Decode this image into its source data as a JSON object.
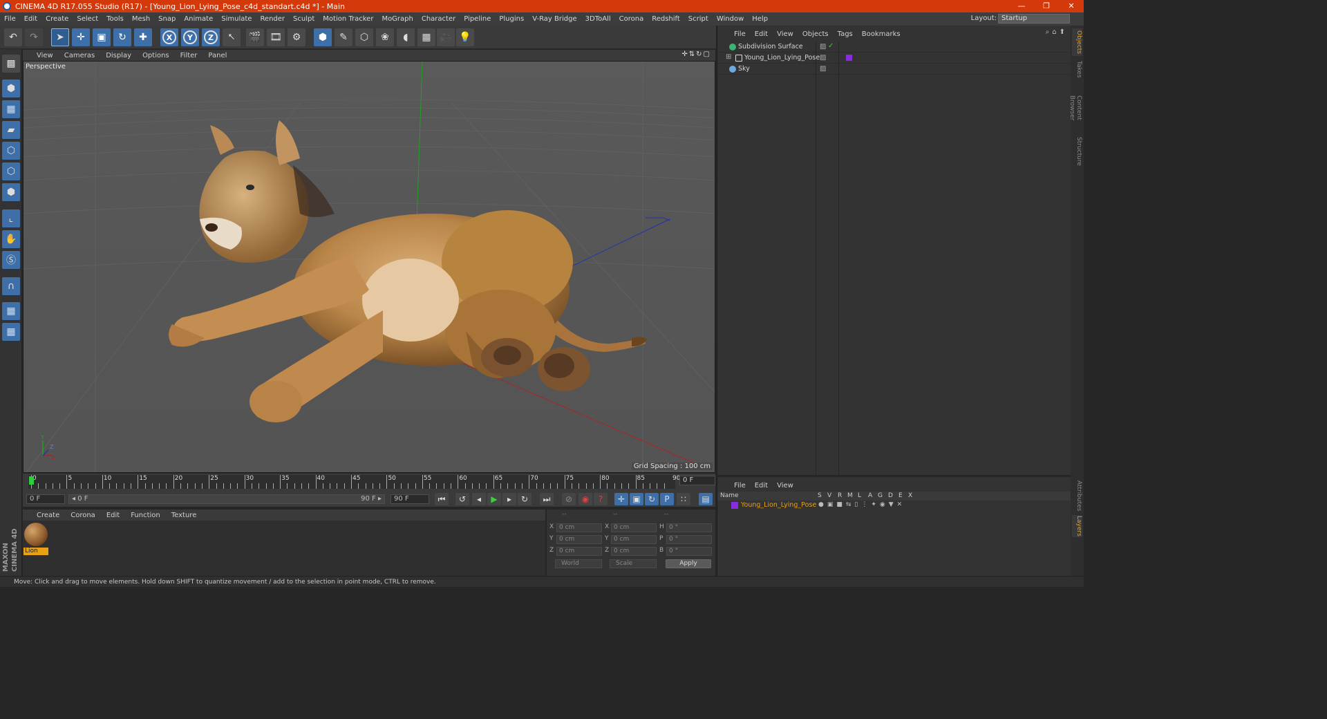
{
  "window": {
    "title": "CINEMA 4D R17.055 Studio (R17) - [Young_Lion_Lying_Pose_c4d_standart.c4d *] - Main",
    "minimize": "—",
    "restore": "❐",
    "close": "✕"
  },
  "menubar": {
    "items": [
      "File",
      "Edit",
      "Create",
      "Select",
      "Tools",
      "Mesh",
      "Snap",
      "Animate",
      "Simulate",
      "Render",
      "Sculpt",
      "Motion Tracker",
      "MoGraph",
      "Character",
      "Pipeline",
      "Plugins",
      "V-Ray Bridge",
      "3DToAll",
      "Corona",
      "Redshift",
      "Script",
      "Window",
      "Help"
    ],
    "layout_label": "Layout:",
    "layout_value": "Startup"
  },
  "toolbar": {
    "axis_x": "X",
    "axis_y": "Y",
    "axis_z": "Z"
  },
  "viewport": {
    "menu": [
      "View",
      "Cameras",
      "Display",
      "Options",
      "Filter",
      "Panel"
    ],
    "label": "Perspective",
    "grid_spacing": "Grid Spacing : 100 cm",
    "colors": {
      "x_axis": "#b22222",
      "y_axis": "#22a022",
      "z_axis": "#2233aa"
    }
  },
  "timeline": {
    "ticks": [
      "0",
      "5",
      "10",
      "15",
      "20",
      "25",
      "30",
      "35",
      "40",
      "45",
      "50",
      "55",
      "60",
      "65",
      "70",
      "75",
      "80",
      "85",
      "90"
    ],
    "current_frame": "0 F",
    "start_field": "0 F",
    "range_start": "◂ 0 F",
    "range_end": "90 F ▸",
    "end_field": "90 F"
  },
  "material_panel": {
    "menu": [
      "Create",
      "Corona",
      "Edit",
      "Function",
      "Texture"
    ],
    "material_name": "Lion"
  },
  "coordinates": {
    "header": [
      "--",
      "--",
      "--"
    ],
    "rows": [
      {
        "l1": "X",
        "v1": "0 cm",
        "l2": "X",
        "v2": "0 cm",
        "l3": "H",
        "v3": "0 °"
      },
      {
        "l1": "Y",
        "v1": "0 cm",
        "l2": "Y",
        "v2": "0 cm",
        "l3": "P",
        "v3": "0 °"
      },
      {
        "l1": "Z",
        "v1": "0 cm",
        "l2": "Z",
        "v2": "0 cm",
        "l3": "B",
        "v3": "0 °"
      }
    ],
    "world": "World",
    "scale": "Scale",
    "apply": "Apply"
  },
  "objects_panel": {
    "menu": [
      "File",
      "Edit",
      "View",
      "Objects",
      "Tags",
      "Bookmarks"
    ],
    "objects": [
      {
        "name": "Subdivision Surface",
        "icon_color": "#3cb371"
      },
      {
        "name": "Young_Lion_Lying_Pose",
        "icon_color": "#d8d8d8"
      },
      {
        "name": "Sky",
        "icon_color": "#6ea8e0"
      }
    ]
  },
  "layers_panel": {
    "menu": [
      "File",
      "Edit",
      "View"
    ],
    "columns": [
      "Name",
      "S",
      "V",
      "R",
      "M",
      "L",
      "A",
      "G",
      "D",
      "E",
      "X"
    ],
    "layer_name": "Young_Lion_Lying_Pose",
    "layer_color": "#8a2be2"
  },
  "side_tabs": [
    "Objects",
    "Takes",
    "Content Browser",
    "Structure"
  ],
  "side_tabs_bottom": [
    "Attributes",
    "Layers"
  ],
  "status": "Move: Click and drag to move elements. Hold down SHIFT to quantize movement / add to the selection in point mode, CTRL to remove.",
  "brand": {
    "line1": "MAXON",
    "line2": "CINEMA 4D"
  }
}
